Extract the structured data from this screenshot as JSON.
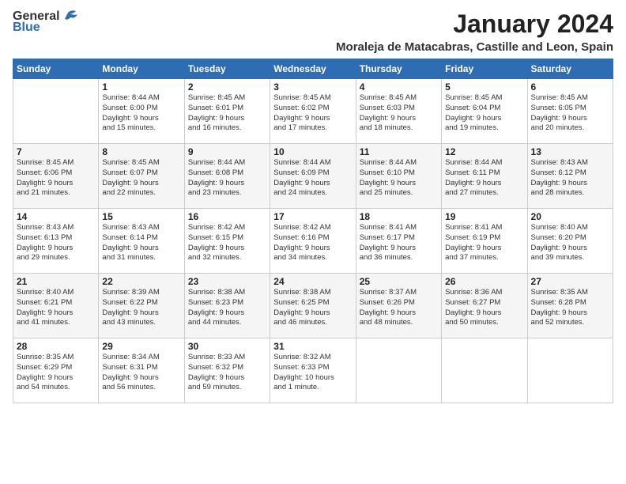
{
  "logo": {
    "general": "General",
    "blue": "Blue"
  },
  "header": {
    "title": "January 2024",
    "location": "Moraleja de Matacabras, Castille and Leon, Spain"
  },
  "weekdays": [
    "Sunday",
    "Monday",
    "Tuesday",
    "Wednesday",
    "Thursday",
    "Friday",
    "Saturday"
  ],
  "weeks": [
    [
      {
        "day": "",
        "content": ""
      },
      {
        "day": "1",
        "content": "Sunrise: 8:44 AM\nSunset: 6:00 PM\nDaylight: 9 hours\nand 15 minutes."
      },
      {
        "day": "2",
        "content": "Sunrise: 8:45 AM\nSunset: 6:01 PM\nDaylight: 9 hours\nand 16 minutes."
      },
      {
        "day": "3",
        "content": "Sunrise: 8:45 AM\nSunset: 6:02 PM\nDaylight: 9 hours\nand 17 minutes."
      },
      {
        "day": "4",
        "content": "Sunrise: 8:45 AM\nSunset: 6:03 PM\nDaylight: 9 hours\nand 18 minutes."
      },
      {
        "day": "5",
        "content": "Sunrise: 8:45 AM\nSunset: 6:04 PM\nDaylight: 9 hours\nand 19 minutes."
      },
      {
        "day": "6",
        "content": "Sunrise: 8:45 AM\nSunset: 6:05 PM\nDaylight: 9 hours\nand 20 minutes."
      }
    ],
    [
      {
        "day": "7",
        "content": "Sunrise: 8:45 AM\nSunset: 6:06 PM\nDaylight: 9 hours\nand 21 minutes."
      },
      {
        "day": "8",
        "content": "Sunrise: 8:45 AM\nSunset: 6:07 PM\nDaylight: 9 hours\nand 22 minutes."
      },
      {
        "day": "9",
        "content": "Sunrise: 8:44 AM\nSunset: 6:08 PM\nDaylight: 9 hours\nand 23 minutes."
      },
      {
        "day": "10",
        "content": "Sunrise: 8:44 AM\nSunset: 6:09 PM\nDaylight: 9 hours\nand 24 minutes."
      },
      {
        "day": "11",
        "content": "Sunrise: 8:44 AM\nSunset: 6:10 PM\nDaylight: 9 hours\nand 25 minutes."
      },
      {
        "day": "12",
        "content": "Sunrise: 8:44 AM\nSunset: 6:11 PM\nDaylight: 9 hours\nand 27 minutes."
      },
      {
        "day": "13",
        "content": "Sunrise: 8:43 AM\nSunset: 6:12 PM\nDaylight: 9 hours\nand 28 minutes."
      }
    ],
    [
      {
        "day": "14",
        "content": "Sunrise: 8:43 AM\nSunset: 6:13 PM\nDaylight: 9 hours\nand 29 minutes."
      },
      {
        "day": "15",
        "content": "Sunrise: 8:43 AM\nSunset: 6:14 PM\nDaylight: 9 hours\nand 31 minutes."
      },
      {
        "day": "16",
        "content": "Sunrise: 8:42 AM\nSunset: 6:15 PM\nDaylight: 9 hours\nand 32 minutes."
      },
      {
        "day": "17",
        "content": "Sunrise: 8:42 AM\nSunset: 6:16 PM\nDaylight: 9 hours\nand 34 minutes."
      },
      {
        "day": "18",
        "content": "Sunrise: 8:41 AM\nSunset: 6:17 PM\nDaylight: 9 hours\nand 36 minutes."
      },
      {
        "day": "19",
        "content": "Sunrise: 8:41 AM\nSunset: 6:19 PM\nDaylight: 9 hours\nand 37 minutes."
      },
      {
        "day": "20",
        "content": "Sunrise: 8:40 AM\nSunset: 6:20 PM\nDaylight: 9 hours\nand 39 minutes."
      }
    ],
    [
      {
        "day": "21",
        "content": "Sunrise: 8:40 AM\nSunset: 6:21 PM\nDaylight: 9 hours\nand 41 minutes."
      },
      {
        "day": "22",
        "content": "Sunrise: 8:39 AM\nSunset: 6:22 PM\nDaylight: 9 hours\nand 43 minutes."
      },
      {
        "day": "23",
        "content": "Sunrise: 8:38 AM\nSunset: 6:23 PM\nDaylight: 9 hours\nand 44 minutes."
      },
      {
        "day": "24",
        "content": "Sunrise: 8:38 AM\nSunset: 6:25 PM\nDaylight: 9 hours\nand 46 minutes."
      },
      {
        "day": "25",
        "content": "Sunrise: 8:37 AM\nSunset: 6:26 PM\nDaylight: 9 hours\nand 48 minutes."
      },
      {
        "day": "26",
        "content": "Sunrise: 8:36 AM\nSunset: 6:27 PM\nDaylight: 9 hours\nand 50 minutes."
      },
      {
        "day": "27",
        "content": "Sunrise: 8:35 AM\nSunset: 6:28 PM\nDaylight: 9 hours\nand 52 minutes."
      }
    ],
    [
      {
        "day": "28",
        "content": "Sunrise: 8:35 AM\nSunset: 6:29 PM\nDaylight: 9 hours\nand 54 minutes."
      },
      {
        "day": "29",
        "content": "Sunrise: 8:34 AM\nSunset: 6:31 PM\nDaylight: 9 hours\nand 56 minutes."
      },
      {
        "day": "30",
        "content": "Sunrise: 8:33 AM\nSunset: 6:32 PM\nDaylight: 9 hours\nand 59 minutes."
      },
      {
        "day": "31",
        "content": "Sunrise: 8:32 AM\nSunset: 6:33 PM\nDaylight: 10 hours\nand 1 minute."
      },
      {
        "day": "",
        "content": ""
      },
      {
        "day": "",
        "content": ""
      },
      {
        "day": "",
        "content": ""
      }
    ]
  ]
}
